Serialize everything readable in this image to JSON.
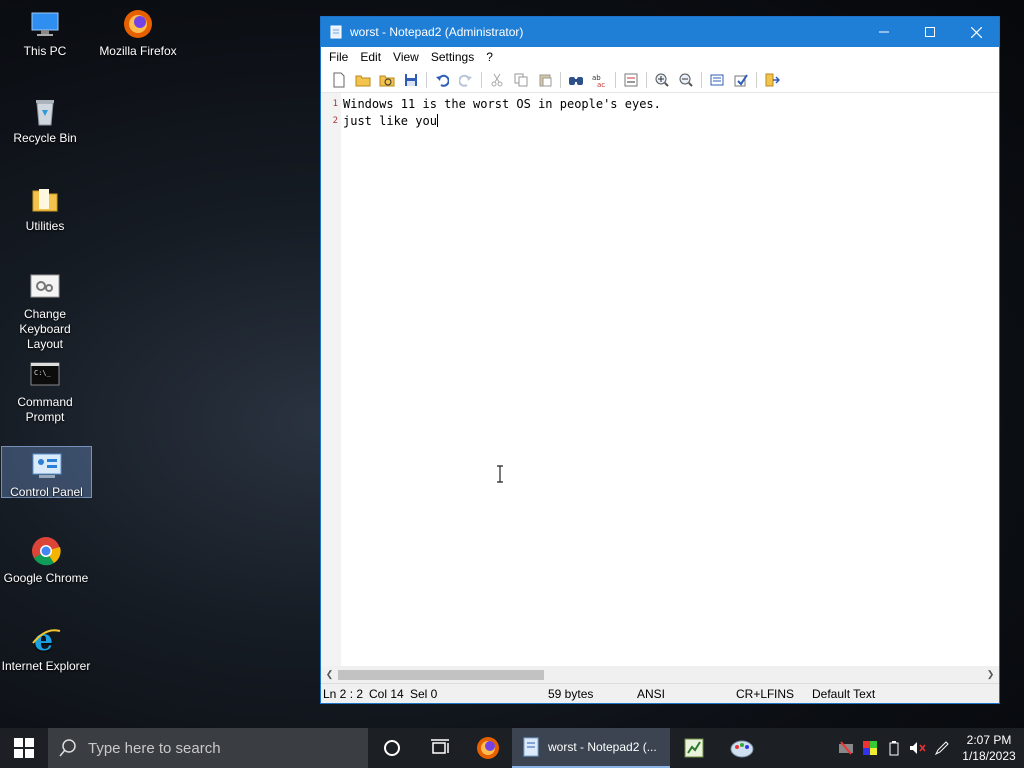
{
  "desktop": {
    "icons": [
      {
        "label": "This PC"
      },
      {
        "label": "Mozilla Firefox"
      },
      {
        "label": "Recycle Bin"
      },
      {
        "label": "Utilities"
      },
      {
        "label": "Change Keyboard Layout"
      },
      {
        "label": "Command Prompt"
      },
      {
        "label": "Control Panel"
      },
      {
        "label": "Google Chrome"
      },
      {
        "label": "Internet Explorer"
      }
    ]
  },
  "window": {
    "title": "worst - Notepad2 (Administrator)",
    "menu": [
      "File",
      "Edit",
      "View",
      "Settings",
      "?"
    ],
    "lines": [
      {
        "num": "1",
        "text": "Windows 11 is the worst OS in people's eyes."
      },
      {
        "num": "2",
        "text": "just like you"
      }
    ],
    "status": {
      "position": "Ln 2 : 2",
      "column": "Col 14",
      "selection": "Sel 0",
      "size": "59 bytes",
      "encoding": "ANSI",
      "line_ending": "CR+LF",
      "mode": "INS",
      "scheme": "Default Text"
    }
  },
  "taskbar": {
    "search_placeholder": "Type here to search",
    "active_app": "worst - Notepad2 (...",
    "time": "2:07 PM",
    "date": "1/18/2023"
  },
  "colors": {
    "titlebar": "#1f7fd6",
    "taskbar": "#1c1f24"
  }
}
